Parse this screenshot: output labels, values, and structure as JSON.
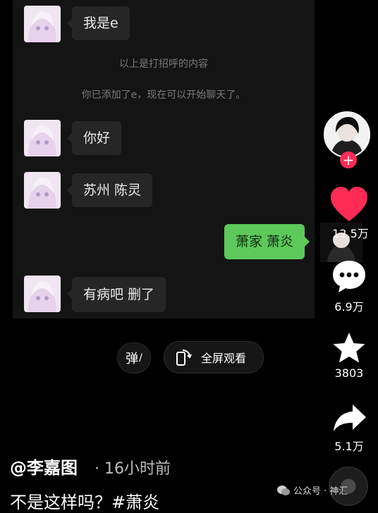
{
  "chat": {
    "messages": [
      {
        "sender": "other",
        "text": "我是e"
      },
      {
        "sender": "system",
        "text": "以上是打招呼的内容"
      },
      {
        "sender": "system",
        "text": "你已添加了e，现在可以开始聊天了。"
      },
      {
        "sender": "other",
        "text": "你好"
      },
      {
        "sender": "other",
        "text": "苏州 陈灵"
      },
      {
        "sender": "me",
        "text": "萧家 萧炎"
      },
      {
        "sender": "other",
        "text": "有病吧 删了"
      }
    ]
  },
  "sidebar": {
    "follow_icon": "plus-icon",
    "like": {
      "icon": "heart-icon",
      "count": "12.5万",
      "color": "#fe2c55"
    },
    "comment": {
      "icon": "comment-icon",
      "count": "6.9万"
    },
    "favorite": {
      "icon": "star-icon",
      "count": "3803"
    },
    "share": {
      "icon": "share-icon",
      "count": "5.1万"
    }
  },
  "controls": {
    "danmaku_label": "弹",
    "fullscreen_label": "全屏观看"
  },
  "video_info": {
    "author": "@李嘉图",
    "time": "· 16小时前",
    "caption": "不是这样吗？#萧炎"
  },
  "watermark": {
    "text": "公众号 · 神汇"
  }
}
